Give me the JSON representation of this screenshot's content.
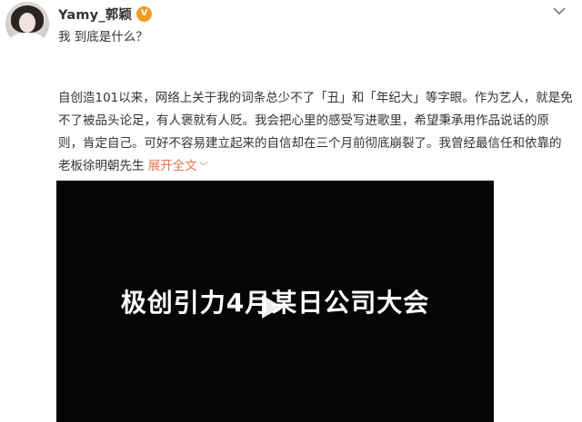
{
  "post": {
    "username": "Yamy_郭颖",
    "verified_mark": "V",
    "intro": "我 到底是什么？",
    "text": "自创造101以来，网络上关于我的词条总少不了「丑」和「年纪大」等字眼。作为艺人，就是免不了被品头论足，有人褒就有人贬。我会把心里的感受写进歌里，希望秉承用作品说话的原则，肯定自己。可好不容易建立起来的自信却在三个月前彻底崩裂了。我曾经最信任和依靠的老板徐明朝先生",
    "expand_label": "展开全文"
  },
  "video": {
    "title": "极创引力4月某日公司大会"
  },
  "colors": {
    "link": "#eb7350",
    "verified": "#f49b1f",
    "video_bg": "#050505"
  },
  "icons": {
    "verified": "verified-badge-icon",
    "menu": "chevron-down-icon",
    "play": "play-icon"
  }
}
